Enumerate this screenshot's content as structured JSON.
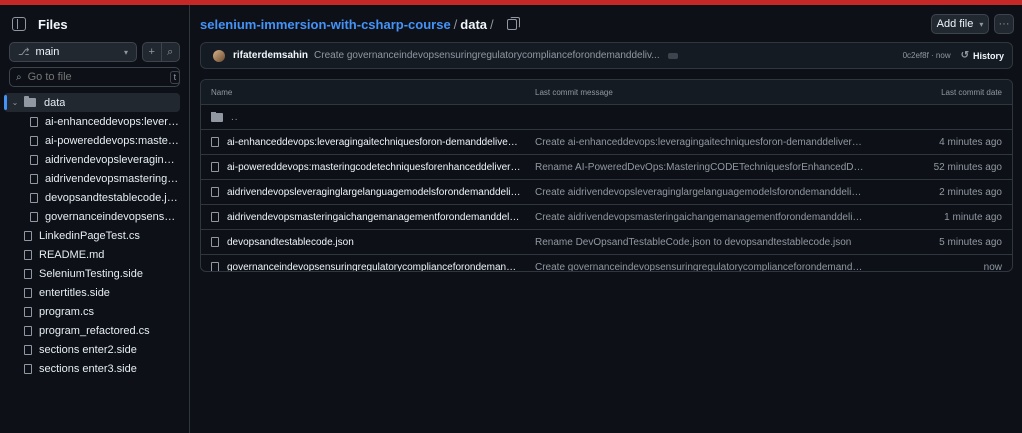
{
  "sidebar": {
    "title": "Files",
    "branch": "main",
    "goto_placeholder": "Go to file",
    "goto_shortcut": "t",
    "items": [
      {
        "label": "data",
        "type": "folder",
        "depth": 0,
        "expanded": true,
        "selected": true
      },
      {
        "label": "ai-enhanceddevops:leveragingai...",
        "type": "file",
        "depth": 1
      },
      {
        "label": "ai-powereddevops:masteringcod...",
        "type": "file",
        "depth": 1
      },
      {
        "label": "aidrivendevopsleveraginglargela...",
        "type": "file",
        "depth": 1
      },
      {
        "label": "aidrivendevopsmasteringaichang...",
        "type": "file",
        "depth": 1
      },
      {
        "label": "devopsandtestablecode.json",
        "type": "file",
        "depth": 1
      },
      {
        "label": "governanceindevopsensuringreg...",
        "type": "file",
        "depth": 1
      },
      {
        "label": "LinkedinPageTest.cs",
        "type": "file",
        "depth": 0
      },
      {
        "label": "README.md",
        "type": "file",
        "depth": 0
      },
      {
        "label": "SeleniumTesting.side",
        "type": "file",
        "depth": 0
      },
      {
        "label": "entertitles.side",
        "type": "file",
        "depth": 0
      },
      {
        "label": "program.cs",
        "type": "file",
        "depth": 0
      },
      {
        "label": "program_refactored.cs",
        "type": "file",
        "depth": 0
      },
      {
        "label": "sections enter2.side",
        "type": "file",
        "depth": 0
      },
      {
        "label": "sections enter3.side",
        "type": "file",
        "depth": 0
      }
    ]
  },
  "breadcrumb": {
    "repo": "selenium-immersion-with-csharp-course",
    "separator": "/",
    "folder": "data",
    "trailing": "/"
  },
  "actions": {
    "add_file": "Add file",
    "more": "···"
  },
  "commit": {
    "author": "rifaterdemsahin",
    "message": "Create governanceindevopsensuringregulatorycomplianceforondemanddeliv...",
    "meta": "0c2ef8f · now",
    "history_label": "History"
  },
  "table": {
    "headers": {
      "name": "Name",
      "message": "Last commit message",
      "date": "Last commit date"
    },
    "parent": "..",
    "rows": [
      {
        "name": "ai-enhanceddevops:leveragingaitechniquesforon-demanddelivery.json",
        "message": "Create ai-enhanceddevops:leveragingaitechniquesforon-demanddelivery.json",
        "date": "4 minutes ago"
      },
      {
        "name": "ai-powereddevops:masteringcodetechniquesforenhanceddeliveryondema...",
        "message": "Rename AI-PoweredDevOps:MasteringCODETechniquesforEnhancedDeliveryonD...",
        "date": "52 minutes ago"
      },
      {
        "name": "aidrivendevopsleveraginglargelanguagemodelsforondemanddelivery.json",
        "message": "Create aidrivendevopsleveraginglargelanguagemodelsforondemanddelivery...",
        "date": "2 minutes ago"
      },
      {
        "name": "aidrivendevopsmasteringaichangemanagementforondemanddelivery.json",
        "message": "Create aidrivendevopsmasteringaichangemanagementforondemanddelivery.json",
        "date": "1 minute ago"
      },
      {
        "name": "devopsandtestablecode.json",
        "message": "Rename DevOpsandTestableCode.json to devopsandtestablecode.json",
        "date": "5 minutes ago"
      },
      {
        "name": "governanceindevopsensuringregulatorycomplianceforondemanddelivery.js...",
        "message": "Create governanceindevopsensuringregulatorycomplianceforondemanddeliv...",
        "date": "now"
      }
    ]
  },
  "colors": {
    "accent": "#4493f8",
    "background": "#0d1117",
    "top_bar": "#c62828"
  }
}
